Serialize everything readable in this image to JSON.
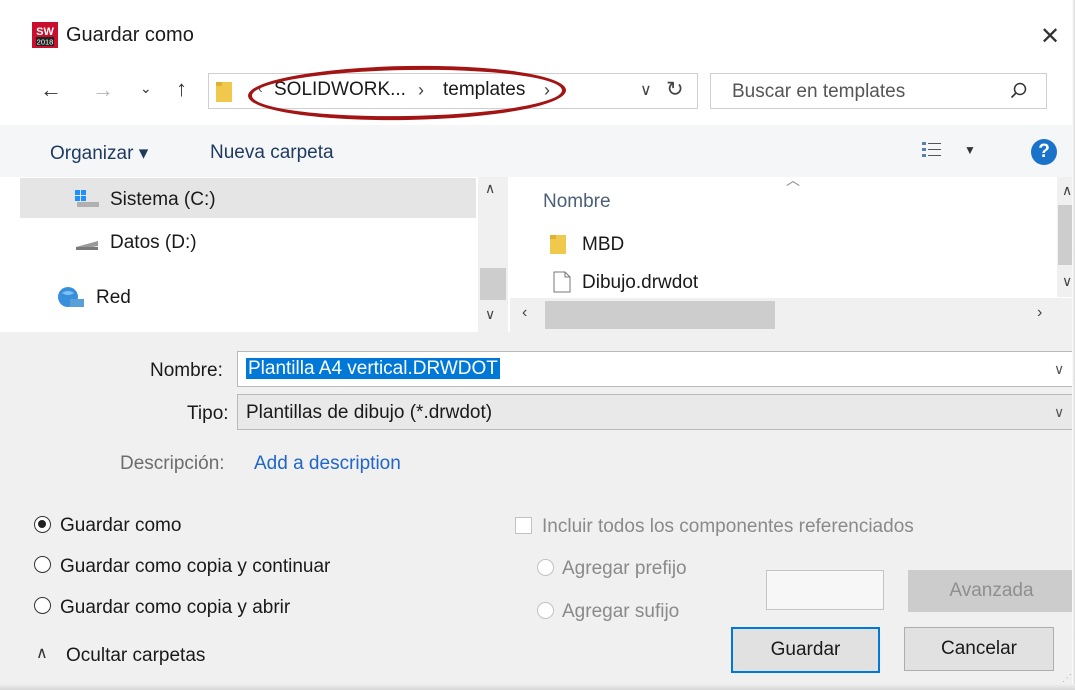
{
  "title_bar": {
    "title": "Guardar como",
    "app_icon": "solidworks-2018-icon",
    "close_glyph": "✕"
  },
  "nav": {
    "breadcrumb": [
      "SOLIDWORK...",
      "templates"
    ],
    "search_placeholder": "Buscar en templates"
  },
  "toolbar": {
    "organize_label": "Organizar ▾",
    "new_folder_label": "Nueva carpeta"
  },
  "left_pane": {
    "items": [
      {
        "label": "Sistema (C:)",
        "icon": "windows-drive-icon",
        "selected": true
      },
      {
        "label": "Datos (D:)",
        "icon": "drive-icon"
      },
      {
        "label": "Red",
        "icon": "network-icon"
      }
    ]
  },
  "file_list": {
    "column_header": "Nombre",
    "items": [
      {
        "name": "MBD",
        "icon": "folder-icon"
      },
      {
        "name": "Dibujo.drwdot",
        "icon": "file-icon"
      }
    ]
  },
  "form": {
    "name_label": "Nombre:",
    "name_value": "Plantilla A4 vertical.DRWDOT",
    "type_label": "Tipo:",
    "type_value": "Plantillas de dibujo (*.drwdot)",
    "description_label": "Descripción:",
    "description_link": "Add a description"
  },
  "save_options": {
    "radios": [
      {
        "label": "Guardar como",
        "checked": true
      },
      {
        "label": "Guardar como copia y continuar",
        "checked": false
      },
      {
        "label": "Guardar como copia y abrir",
        "checked": false
      }
    ],
    "include_checkbox": "Incluir todos los componentes referenciados",
    "prefix_label": "Agregar prefijo",
    "suffix_label": "Agregar sufijo",
    "advanced_label": "Avanzada"
  },
  "footer": {
    "hide_folders_label": "Ocultar carpetas",
    "save_label": "Guardar",
    "cancel_label": "Cancelar"
  },
  "colors": {
    "accent": "#0078d7",
    "annotation": "#a31414",
    "help": "#1a73c9"
  }
}
